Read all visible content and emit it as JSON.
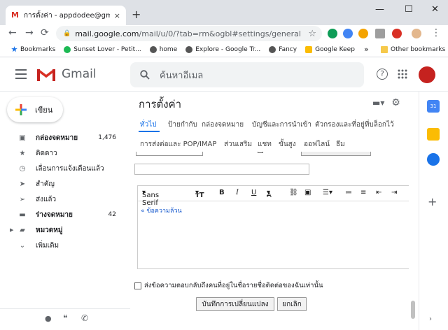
{
  "browser": {
    "tab_title": "การตั้งค่า - appdodee@gmail.com",
    "tab_close": "×",
    "new_tab": "+",
    "win_min": "—",
    "win_max": "☐",
    "win_close": "✕",
    "url_host": "mail.google.com",
    "url_path": "/mail/u/0/?tab=rm&ogbl#settings/general",
    "back": "←",
    "forward": "→",
    "reload": "⟳",
    "lock": "🔒",
    "star": "☆",
    "menu": "⋮"
  },
  "bookmarks": {
    "items": [
      "Bookmarks",
      "Sunset Lover - Petit...",
      "home",
      "Explore - Google Tr...",
      "Fancy",
      "Google Keep"
    ],
    "more": "»",
    "other": "Other bookmarks"
  },
  "gmail": {
    "brand": "Gmail",
    "search_placeholder": "ค้นหาอีเมล",
    "compose": "เขียน",
    "nav": [
      {
        "label": "กล่องจดหมาย",
        "count": "1,476",
        "icon": "inbox-icon"
      },
      {
        "label": "ติดดาว",
        "count": "",
        "icon": "star-icon"
      },
      {
        "label": "เลื่อนการแจ้งเตือนแล้ว",
        "count": "",
        "icon": "clock-icon"
      },
      {
        "label": "สำคัญ",
        "count": "",
        "icon": "important-icon"
      },
      {
        "label": "ส่งแล้ว",
        "count": "",
        "icon": "send-icon"
      },
      {
        "label": "ร่างจดหมาย",
        "count": "42",
        "icon": "draft-icon"
      },
      {
        "label": "หมวดหมู่",
        "count": "",
        "icon": "label-icon"
      },
      {
        "label": "เพิ่มเติม",
        "count": "",
        "icon": "chevron-down-icon"
      }
    ]
  },
  "settings": {
    "title": "การตั้งค่า",
    "tabs_row1": [
      "ทั่วไป",
      "ป้ายกำกับ",
      "กล่องจดหมาย",
      "บัญชีและการนำเข้า",
      "ตัวกรองและที่อยู่ที่บล็อกไว้"
    ],
    "tabs_row2": [
      "การส่งต่อและ POP/IMAP",
      "ส่วนเสริม",
      "แชท",
      "ขั้นสูง",
      "ออฟไลน์",
      "ธีม"
    ],
    "toolbar": {
      "font": "Sans Serif",
      "size": "тT",
      "bold": "B",
      "italic": "I",
      "underline": "U",
      "color": "A"
    },
    "quoted_link": "« ข้อความล้วน",
    "reply_option": "ส่งข้อความตอบกลับถึงคนที่อยู่ในชื่อรายชื่อติดต่อของฉันเท่านั้น",
    "save_button": "บันทึกการเปลี่ยนแปลง",
    "cancel_button": "ยกเลิก"
  },
  "colors": {
    "accent": "#1a73e8",
    "gmail_red": "#d93025"
  }
}
